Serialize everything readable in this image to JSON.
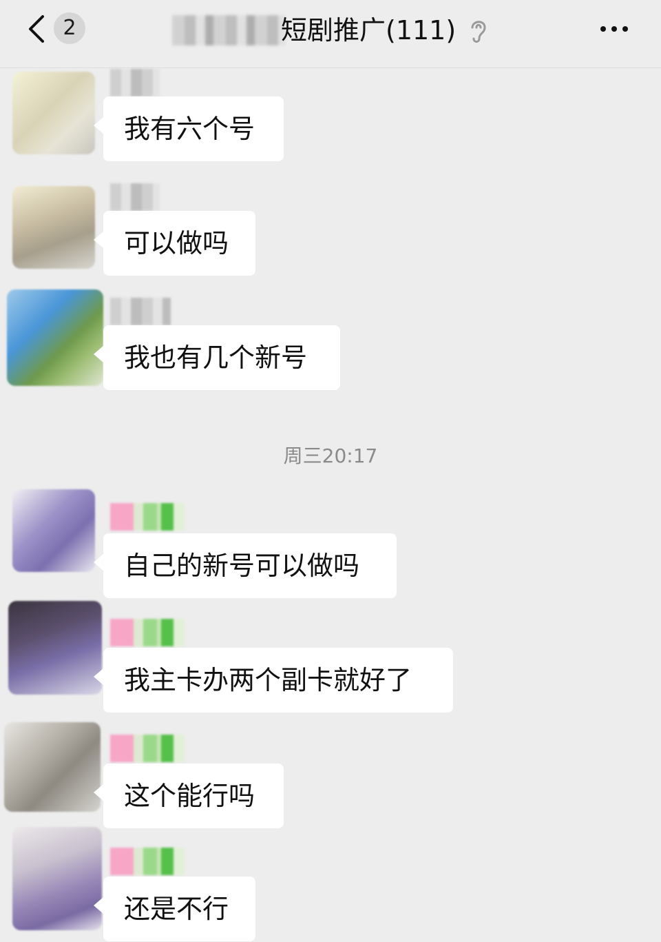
{
  "header": {
    "unread_count": "2",
    "title": "短剧推广(111)",
    "icons": {
      "back": "chevron-left-icon",
      "mute": "ear-icon",
      "more": "more-dots-icon"
    }
  },
  "messages_before": [
    {
      "text": "我有六个号"
    },
    {
      "text": "可以做吗"
    },
    {
      "text": "我也有几个新号"
    }
  ],
  "timestamp": "周三20:17",
  "messages_after": [
    {
      "text": "自己的新号可以做吗"
    },
    {
      "text": "我主卡办两个副卡就好了"
    },
    {
      "text": "这个能行吗"
    },
    {
      "text": "还是不行"
    }
  ],
  "colors": {
    "background": "#ededed",
    "bubble": "#ffffff",
    "text": "#111111",
    "timestamp": "#8a8a8a"
  }
}
